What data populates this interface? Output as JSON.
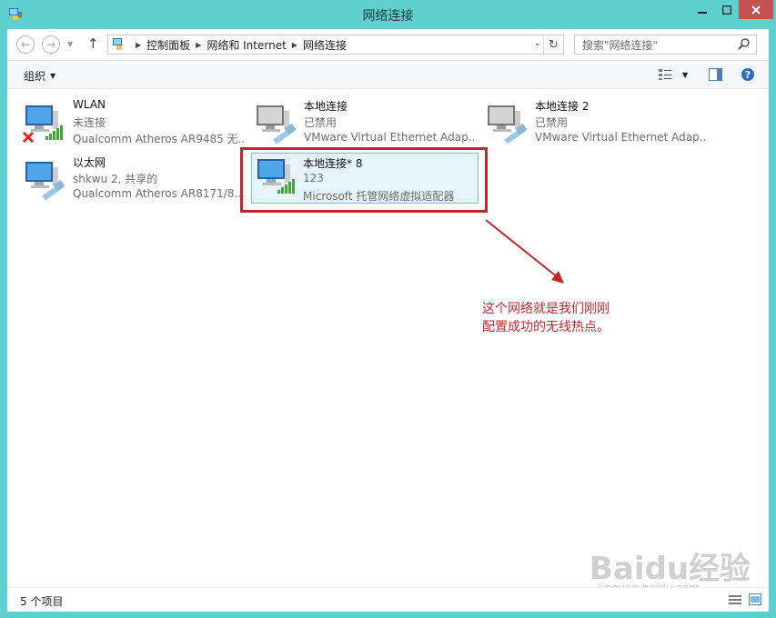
{
  "window": {
    "title": "网络连接"
  },
  "address": {
    "crumbs": [
      "控制面板",
      "网络和 Internet",
      "网络连接"
    ]
  },
  "search": {
    "placeholder": "搜索\"网络连接\""
  },
  "toolbar": {
    "organize_label": "组织"
  },
  "items": [
    {
      "name": "WLAN",
      "status": "未连接",
      "device": "Qualcomm Atheros AR9485 无...",
      "icon": "wireless-adapter-disconnected-icon"
    },
    {
      "name": "本地连接",
      "status": "已禁用",
      "device": "VMware Virtual Ethernet Adap...",
      "icon": "ethernet-adapter-disabled-icon"
    },
    {
      "name": "本地连接 2",
      "status": "已禁用",
      "device": "VMware Virtual Ethernet Adap...",
      "icon": "ethernet-adapter-disabled-icon"
    },
    {
      "name": "以太网",
      "status": "shkwu  2, 共享的",
      "device": "Qualcomm Atheros AR8171/8...",
      "icon": "ethernet-adapter-icon"
    },
    {
      "name": "本地连接* 8",
      "status": "123",
      "device": "Microsoft 托管网络虚拟适配器",
      "icon": "wireless-adapter-connected-icon"
    }
  ],
  "annotation": {
    "line1": "这个网络就是我们刚刚",
    "line2": "配置成功的无线热点。",
    "color": "#c0272d"
  },
  "statusbar": {
    "count": "5 个项目"
  },
  "watermark": {
    "logo": "Baidu经验",
    "url": "jingyan.baidu.com"
  }
}
